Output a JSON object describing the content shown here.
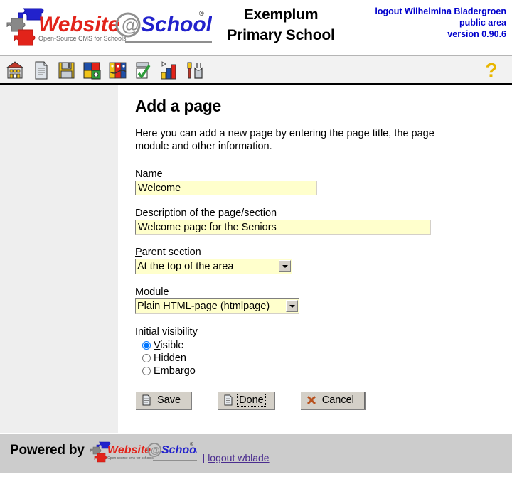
{
  "header": {
    "logo_alt": "Website@School",
    "logo_word1": "Website",
    "logo_at": "@",
    "logo_word2": "School",
    "logo_tagline": "Open-Source CMS for Schools",
    "logo_registered": "®",
    "school_name_line1": "Exemplum",
    "school_name_line2": "Primary School",
    "logout_label": "logout Wilhelmina Bladergroen",
    "area_label": "public area",
    "version_label": "version 0.90.6"
  },
  "toolbar": {
    "icons": [
      {
        "name": "school-icon",
        "title": "Home"
      },
      {
        "name": "page-icon",
        "title": "Pages"
      },
      {
        "name": "save-disk-icon",
        "title": "File manager"
      },
      {
        "name": "modules-puzzle-icon",
        "title": "Modules"
      },
      {
        "name": "users-faces-icon",
        "title": "Users"
      },
      {
        "name": "checklist-icon",
        "title": "Page manager"
      },
      {
        "name": "statistics-chart-icon",
        "title": "Statistics"
      },
      {
        "name": "tools-icon",
        "title": "Tools"
      }
    ],
    "help_icon": "question-mark-icon",
    "help_label": "?"
  },
  "main": {
    "title": "Add a page",
    "intro": "Here you can add a new page by entering the page title, the page module and other information.",
    "fields": {
      "name": {
        "label_accesskey": "N",
        "label_rest": "ame",
        "value": "Welcome",
        "placeholder": ""
      },
      "description": {
        "label_accesskey": "D",
        "label_rest": "escription of the page/section",
        "value": "Welcome page for the Seniors",
        "placeholder": ""
      },
      "parent_section": {
        "label_accesskey": "P",
        "label_rest": "arent section",
        "value": "At the top of the area",
        "options": [
          "At the top of the area"
        ]
      },
      "module": {
        "label_accesskey": "M",
        "label_rest": "odule",
        "value": "Plain HTML-page (htmlpage)",
        "options": [
          "Plain HTML-page (htmlpage)"
        ]
      },
      "visibility": {
        "label": "Initial visibility",
        "selected": "visible",
        "options": [
          {
            "id": "visible",
            "accesskey": "V",
            "rest": "isible",
            "checked": true
          },
          {
            "id": "hidden",
            "accesskey": "H",
            "rest": "idden",
            "checked": false
          },
          {
            "id": "embargo",
            "accesskey": "E",
            "rest": "mbargo",
            "checked": false
          }
        ]
      }
    },
    "buttons": [
      {
        "name": "save-button",
        "label": "Save",
        "icon": "page-icon",
        "focused": false
      },
      {
        "name": "done-button",
        "label": "Done",
        "icon": "page-icon",
        "focused": true
      },
      {
        "name": "cancel-button",
        "label": "Cancel",
        "icon": "cross-icon",
        "focused": false
      }
    ]
  },
  "footer": {
    "powered_by": "Powered by",
    "logo_word1": "Website",
    "logo_at": "@",
    "logo_word2": "School",
    "logo_tagline": "Open source cms for schools",
    "separator": "|",
    "logout_link": "logout wblade"
  },
  "colors": {
    "accent_blue": "#0000cc",
    "logo_red": "#e2231a",
    "logo_blue": "#2222cc",
    "logo_gray": "#888888",
    "field_yellow": "#ffffcc",
    "sidebar_gray": "#eeeeee",
    "footer_gray": "#cccccc",
    "link_purple": "#4b2d8f"
  }
}
